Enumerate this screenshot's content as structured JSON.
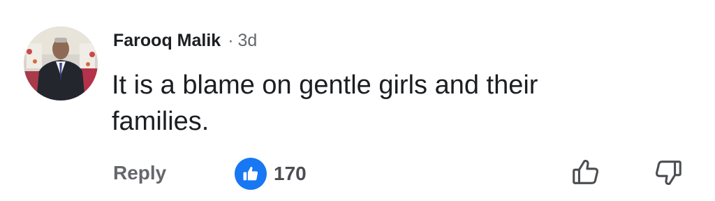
{
  "comment": {
    "author": "Farooq Malik",
    "separator": "·",
    "timestamp": "3d",
    "text": "It is a blame on gentle girls and their families.",
    "reply_label": "Reply",
    "reaction_count": "170",
    "reaction_icon": "thumbs-up-icon",
    "upvote_icon": "thumbs-up-outline-icon",
    "downvote_icon": "thumbs-down-outline-icon"
  },
  "colors": {
    "like_blue": "#1877f2",
    "secondary_text": "#65676b",
    "primary_text": "#1c1e21"
  }
}
